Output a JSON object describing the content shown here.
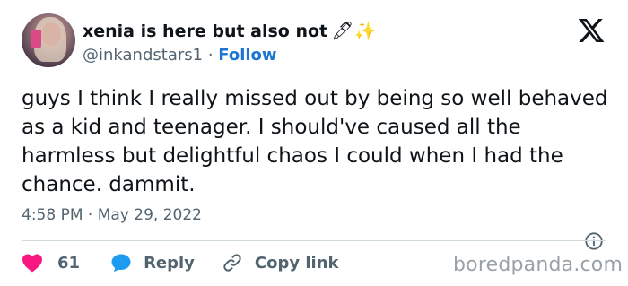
{
  "author": {
    "display_name": "xenia is here but also not",
    "name_emoji": "🖋✨",
    "handle": "@inkandstars1",
    "separator": "·",
    "follow_label": "Follow"
  },
  "tweet": {
    "text": "guys I think I really missed out by being so well behaved as a kid and teenager. I should've caused all the harmless but delightful chaos I could when I had the chance. dammit.",
    "timestamp": "4:58 PM · May 29, 2022"
  },
  "actions": {
    "like_count": "61",
    "reply_label": "Reply",
    "copy_link_label": "Copy link"
  },
  "watermark": "boredpanda.com",
  "icons": [
    "x-logo-icon",
    "info-icon",
    "heart-icon",
    "reply-bubble-icon",
    "link-icon"
  ],
  "colors": {
    "text": "#0f1419",
    "secondary": "#536471",
    "follow": "#1d76d2",
    "heart": "#f91880",
    "reply": "#1d9bf0",
    "watermark": "#9aa2a8"
  }
}
